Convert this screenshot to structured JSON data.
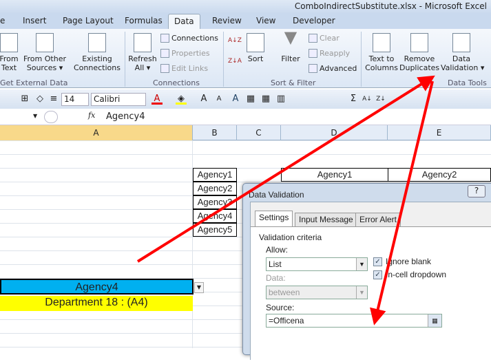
{
  "window": {
    "title": "ComboIndirectSubstitute.xlsx - Microsoft Excel"
  },
  "tabs": [
    "e",
    "Insert",
    "Page Layout",
    "Formulas",
    "Data",
    "Review",
    "View",
    "Developer"
  ],
  "ribbon": {
    "get_external": {
      "from_text": "From\nText",
      "from_other": "From Other\nSources ▾",
      "existing": "Existing\nConnections",
      "label": "Get External Data"
    },
    "connections": {
      "refresh": "Refresh\nAll ▾",
      "connections": "Connections",
      "properties": "Properties",
      "edit_links": "Edit Links",
      "label": "Connections"
    },
    "sort_filter": {
      "sort": "Sort",
      "filter": "Filter",
      "clear": "Clear",
      "reapply": "Reapply",
      "advanced": "Advanced",
      "label": "Sort & Filter"
    },
    "data_tools": {
      "text_to_columns": "Text to\nColumns",
      "remove_duplicates": "Remove\nDuplicates",
      "data_validation": "Data\nValidation ▾",
      "label": "Data Tools"
    }
  },
  "toolbar": {
    "font_size": "14",
    "font_name": "Calibri"
  },
  "formula_bar": {
    "fx": "fx",
    "value": "Agency4"
  },
  "columns": [
    "A",
    "B",
    "C",
    "D",
    "E"
  ],
  "sheet": {
    "agency_list": [
      "Agency1",
      "Agency2",
      "Agency3",
      "Agency4",
      "Agency5"
    ],
    "header_d": "Agency1",
    "header_e": "Agency2",
    "selected_cell": "Agency4",
    "department_cell": "Department 18 : (A4)"
  },
  "colors": {
    "selected_fill": "#00b0f0",
    "department_fill": "#ffff00",
    "arrow": "#ff0000"
  },
  "dialog": {
    "title": "Data Validation",
    "help": "?",
    "tabs": [
      "Settings",
      "Input Message",
      "Error Alert"
    ],
    "criteria_label": "Validation criteria",
    "allow_label": "Allow:",
    "allow_value": "List",
    "ignore_blank": "Ignore blank",
    "ignore_blank_checked": true,
    "incell_dropdown": "In-cell dropdown",
    "incell_checked": true,
    "data_label": "Data:",
    "data_value": "between",
    "source_label": "Source:",
    "source_value": "=Officena"
  }
}
